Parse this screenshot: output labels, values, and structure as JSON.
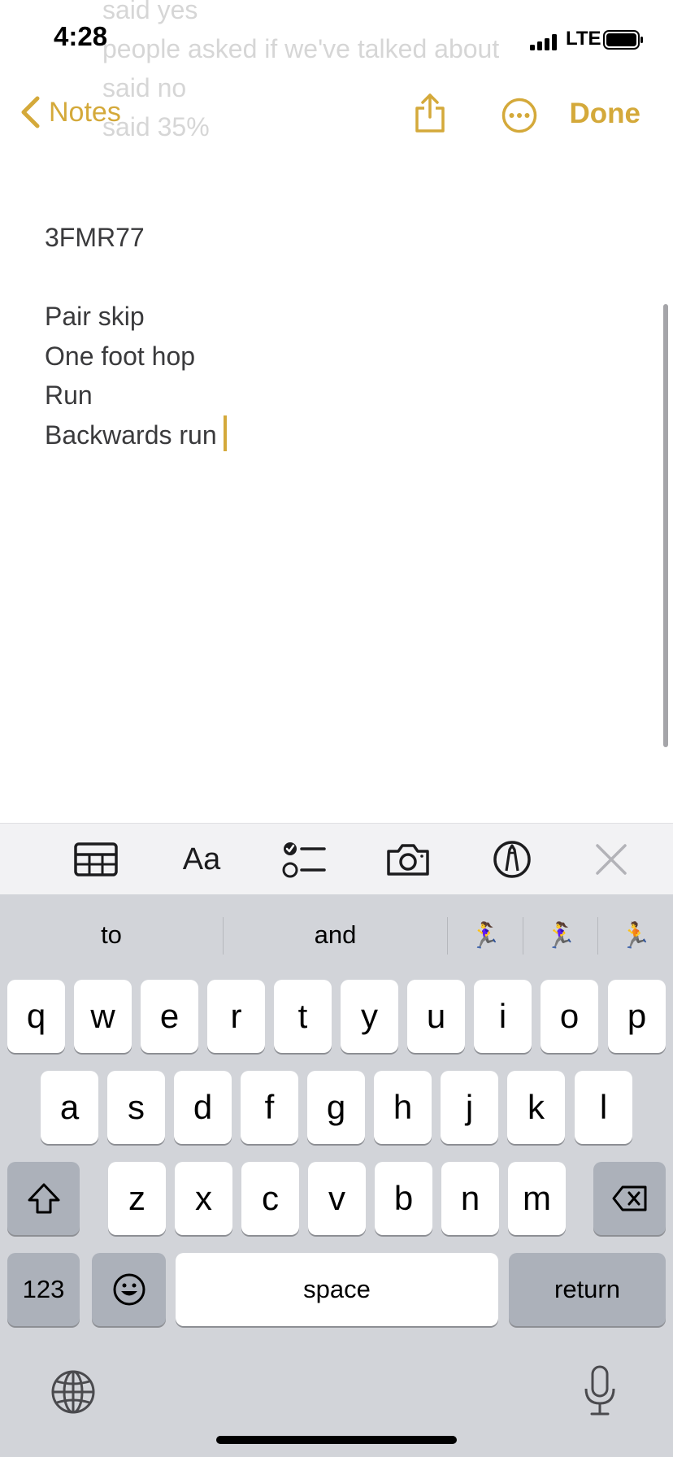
{
  "status_bar": {
    "time": "4:28",
    "network": "LTE"
  },
  "ghost_text": [
    "said yes",
    "people asked if we've talked about",
    "said no",
    "said 35%"
  ],
  "nav": {
    "back_label": "Notes",
    "done_label": "Done",
    "share_icon": "share-icon",
    "more_icon": "ellipsis-circle-icon"
  },
  "note": {
    "lines": [
      "3FMR77",
      "",
      "Pair skip",
      "One foot hop",
      "Run",
      "Backwards run"
    ]
  },
  "toolbar": {
    "format_label": "Aa",
    "icons": [
      "table-icon",
      "text-format-icon",
      "checklist-icon",
      "camera-icon",
      "markup-pen-icon",
      "close-icon"
    ]
  },
  "keyboard": {
    "suggestions": [
      "to",
      "and",
      "🏃‍♀️",
      "🏃‍♀️",
      "🏃"
    ],
    "row1": [
      "q",
      "w",
      "e",
      "r",
      "t",
      "y",
      "u",
      "i",
      "o",
      "p"
    ],
    "row2": [
      "a",
      "s",
      "d",
      "f",
      "g",
      "h",
      "j",
      "k",
      "l"
    ],
    "row3": [
      "z",
      "x",
      "c",
      "v",
      "b",
      "n",
      "m"
    ],
    "numbers_label": "123",
    "space_label": "space",
    "return_label": "return"
  },
  "colors": {
    "accent": "#d4a93a",
    "keyboard_bg": "#d2d4d9",
    "key_dark": "#acb1ba"
  }
}
